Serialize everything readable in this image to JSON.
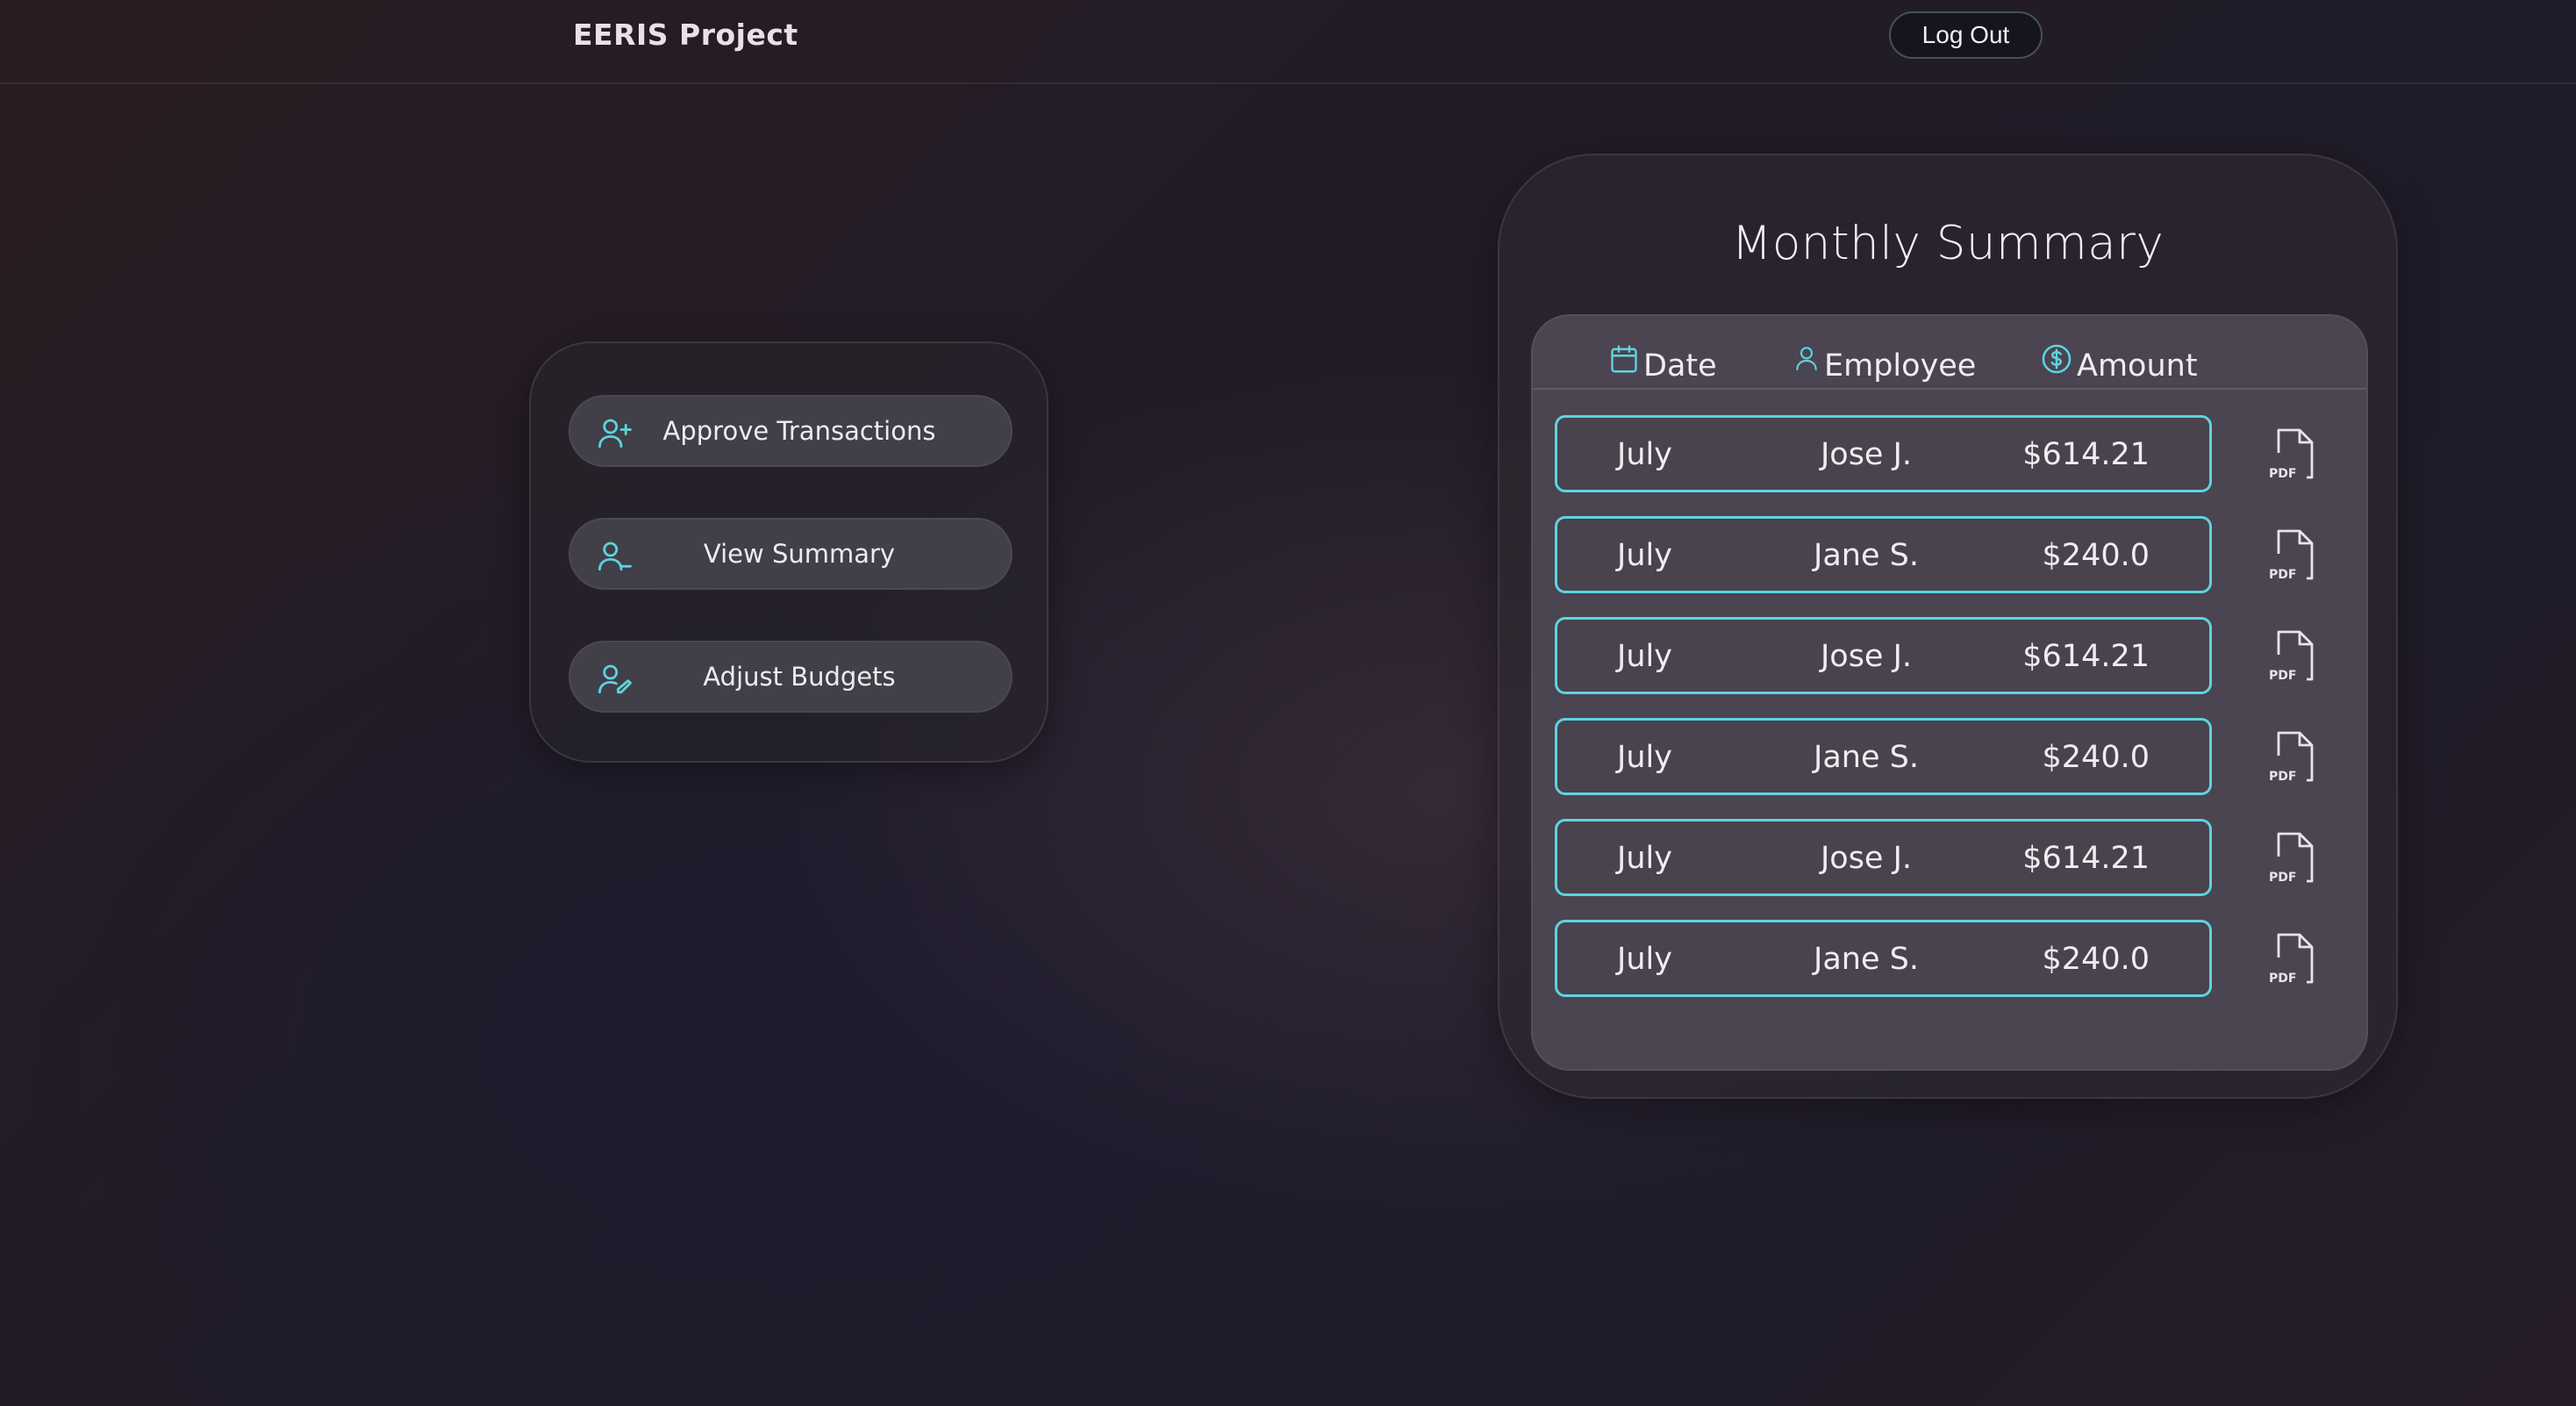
{
  "header": {
    "brand": "EERIS Project",
    "logout_label": "Log Out"
  },
  "menu": {
    "items": [
      {
        "label": "Approve Transactions",
        "icon": "user-plus-icon"
      },
      {
        "label": "View Summary",
        "icon": "user-minus-icon"
      },
      {
        "label": "Adjust Budgets",
        "icon": "user-pen-icon"
      }
    ]
  },
  "summary": {
    "title": "Monthly Summary",
    "columns": {
      "date": "Date",
      "employee": "Employee",
      "amount": "Amount"
    },
    "rows": [
      {
        "date": "July",
        "employee": "Jose J.",
        "amount": "$614.21",
        "action_icon": "pdf-icon"
      },
      {
        "date": "July",
        "employee": "Jane S.",
        "amount": "$240.0",
        "action_icon": "pdf-icon"
      },
      {
        "date": "July",
        "employee": "Jose J.",
        "amount": "$614.21",
        "action_icon": "pdf-icon"
      },
      {
        "date": "July",
        "employee": "Jane S.",
        "amount": "$240.0",
        "action_icon": "pdf-icon"
      },
      {
        "date": "July",
        "employee": "Jose J.",
        "amount": "$614.21",
        "action_icon": "pdf-icon"
      },
      {
        "date": "July",
        "employee": "Jane S.",
        "amount": "$240.0",
        "action_icon": "pdf-icon"
      }
    ],
    "pdf_label": "PDF"
  },
  "colors": {
    "accent": "#5fd3e0",
    "button_bg": "#413f48",
    "panel_bg": "#4a4550"
  }
}
